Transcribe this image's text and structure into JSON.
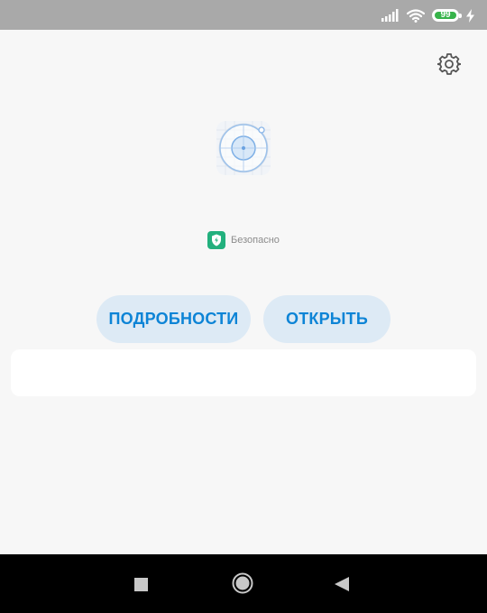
{
  "status_bar": {
    "battery_level": "99",
    "battery_color": "#37b34a",
    "icons": [
      "signal-icon",
      "wifi-icon",
      "battery-icon",
      "charging-icon"
    ]
  },
  "header": {
    "settings_icon": "gear-icon"
  },
  "app": {
    "icon": "app-target-icon",
    "safety_badge_icon": "shield-check-icon",
    "safety_label": "Безопасно"
  },
  "actions": {
    "details_label": "ПОДРОБНОСТИ",
    "open_label": "ОТКРЫТЬ",
    "accent_color": "#0d84d6",
    "button_bg": "#ddeaf5"
  },
  "nav_bar": {
    "icons": [
      "recent-apps-icon",
      "home-icon",
      "back-icon"
    ]
  }
}
